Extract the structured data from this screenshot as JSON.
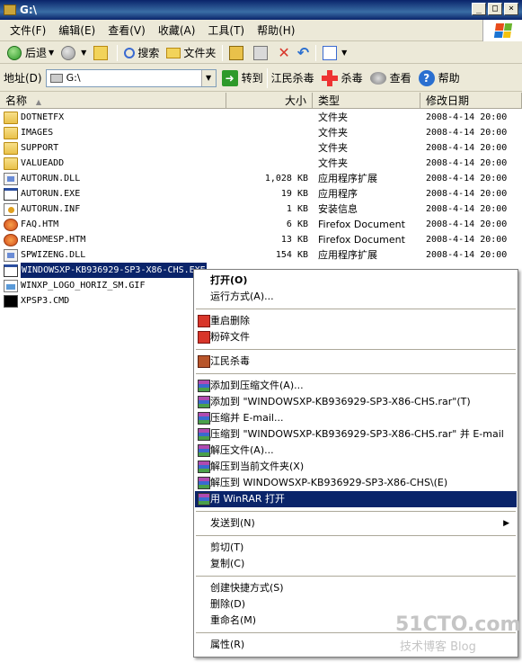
{
  "window": {
    "title": "G:\\"
  },
  "window_buttons": [
    "_",
    "□",
    "×"
  ],
  "menubar": [
    "文件(F)",
    "编辑(E)",
    "查看(V)",
    "收藏(A)",
    "工具(T)",
    "帮助(H)"
  ],
  "toolbar": {
    "back": "后退",
    "search": "搜索",
    "folders": "文件夹"
  },
  "addressbar": {
    "label": "地址(D)",
    "value": "G:\\",
    "go": "转到",
    "jiangmin": "江民杀毒",
    "kill": "杀毒",
    "scan": "查看",
    "help": "帮助"
  },
  "columns": {
    "name": "名称",
    "size": "大小",
    "type": "类型",
    "modified": "修改日期"
  },
  "files": [
    {
      "name": "DOTNETFX",
      "size": "",
      "type": "文件夹",
      "date": "2008-4-14 20:00",
      "icon": "folder"
    },
    {
      "name": "IMAGES",
      "size": "",
      "type": "文件夹",
      "date": "2008-4-14 20:00",
      "icon": "folder"
    },
    {
      "name": "SUPPORT",
      "size": "",
      "type": "文件夹",
      "date": "2008-4-14 20:00",
      "icon": "folder"
    },
    {
      "name": "VALUEADD",
      "size": "",
      "type": "文件夹",
      "date": "2008-4-14 20:00",
      "icon": "folder"
    },
    {
      "name": "AUTORUN.DLL",
      "size": "1,028 KB",
      "type": "应用程序扩展",
      "date": "2008-4-14 20:00",
      "icon": "dll"
    },
    {
      "name": "AUTORUN.EXE",
      "size": "19 KB",
      "type": "应用程序",
      "date": "2008-4-14 20:00",
      "icon": "exe"
    },
    {
      "name": "AUTORUN.INF",
      "size": "1 KB",
      "type": "安装信息",
      "date": "2008-4-14 20:00",
      "icon": "inf"
    },
    {
      "name": "FAQ.HTM",
      "size": "6 KB",
      "type": "Firefox Document",
      "date": "2008-4-14 20:00",
      "icon": "htm"
    },
    {
      "name": "READMESP.HTM",
      "size": "13 KB",
      "type": "Firefox Document",
      "date": "2008-4-14 20:00",
      "icon": "htm"
    },
    {
      "name": "SPWIZENG.DLL",
      "size": "154 KB",
      "type": "应用程序扩展",
      "date": "2008-4-14 20:00",
      "icon": "dll"
    },
    {
      "name": "WINDOWSXP-KB936929-SP3-X86-CHS.EXE",
      "size": "",
      "type": "",
      "date": "",
      "icon": "exe",
      "selected": true
    },
    {
      "name": "WINXP_LOGO_HORIZ_SM.GIF",
      "size": "",
      "type": "",
      "date": "",
      "icon": "gif"
    },
    {
      "name": "XPSP3.CMD",
      "size": "",
      "type": "",
      "date": "",
      "icon": "cmd"
    }
  ],
  "context_menu": [
    {
      "label": "打开(O)",
      "bold": true
    },
    {
      "label": "运行方式(A)..."
    },
    {
      "sep": true
    },
    {
      "label": "重启删除",
      "icon": "red"
    },
    {
      "label": "粉碎文件",
      "icon": "red"
    },
    {
      "sep": true
    },
    {
      "label": "江民杀毒",
      "icon": "jm"
    },
    {
      "sep": true
    },
    {
      "label": "添加到压缩文件(A)...",
      "icon": "rar"
    },
    {
      "label": "添加到 \"WINDOWSXP-KB936929-SP3-X86-CHS.rar\"(T)",
      "icon": "rar"
    },
    {
      "label": "压缩并 E-mail...",
      "icon": "rar"
    },
    {
      "label": "压缩到 \"WINDOWSXP-KB936929-SP3-X86-CHS.rar\" 并 E-mail",
      "icon": "rar"
    },
    {
      "label": "解压文件(A)...",
      "icon": "rar"
    },
    {
      "label": "解压到当前文件夹(X)",
      "icon": "rar"
    },
    {
      "label": "解压到 WINDOWSXP-KB936929-SP3-X86-CHS\\(E)",
      "icon": "rar"
    },
    {
      "label": "用 WinRAR 打开",
      "icon": "rar",
      "highlighted": true
    },
    {
      "sep": true
    },
    {
      "label": "发送到(N)",
      "submenu": true
    },
    {
      "sep": true
    },
    {
      "label": "剪切(T)"
    },
    {
      "label": "复制(C)"
    },
    {
      "sep": true
    },
    {
      "label": "创建快捷方式(S)"
    },
    {
      "label": "删除(D)"
    },
    {
      "label": "重命名(M)"
    },
    {
      "sep": true
    },
    {
      "label": "属性(R)"
    }
  ],
  "watermark": {
    "line1": "51CTO.com",
    "line2": "技术博客 Blog"
  }
}
